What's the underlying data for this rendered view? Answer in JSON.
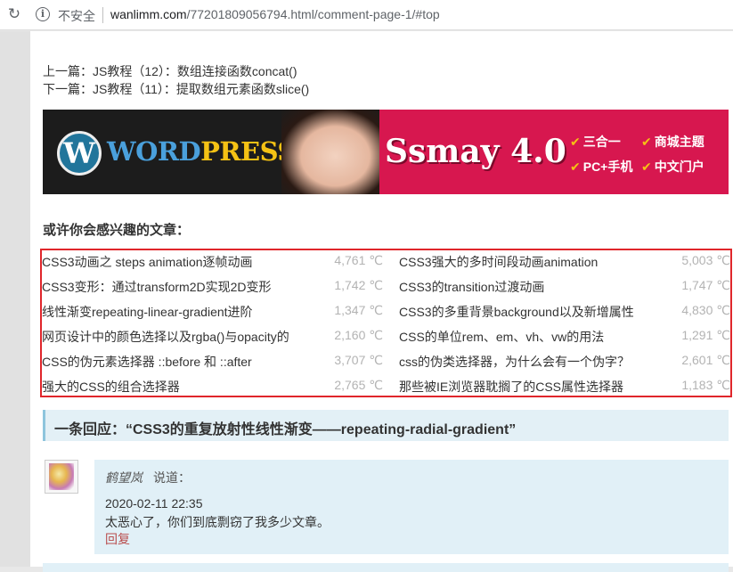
{
  "browser": {
    "security_label": "不安全",
    "url_domain": "wanlimm.com",
    "url_path": "/77201809056794.html/comment-page-1/#top"
  },
  "nav": {
    "prev": "上一篇：JS教程（12）：数组连接函数concat()",
    "next": "下一篇：JS教程（11）：提取数组元素函数slice()"
  },
  "banner": {
    "wp_first": "W",
    "wp_word1": "ORD",
    "wp_word2": "PRESS",
    "product": "Ssmay 4.0",
    "features": [
      "三合一",
      "商城主题",
      "PC+手机",
      "中文门户"
    ]
  },
  "related": {
    "heading": "或许你会感兴趣的文章：",
    "items": [
      {
        "title": "CSS3动画之 steps animation逐帧动画",
        "count": "4,761 ℃"
      },
      {
        "title": "CSS3强大的多时间段动画animation",
        "count": "5,003 ℃"
      },
      {
        "title": "CSS3变形：通过transform2D实现2D变形",
        "count": "1,742 ℃"
      },
      {
        "title": "CSS3的transition过渡动画",
        "count": "1,747 ℃"
      },
      {
        "title": "线性渐变repeating-linear-gradient进阶",
        "count": "1,347 ℃"
      },
      {
        "title": "CSS3的多重背景background以及新增属性",
        "count": "4,830 ℃"
      },
      {
        "title": "网页设计中的颜色选择以及rgba()与opacity的",
        "count": "2,160 ℃"
      },
      {
        "title": "CSS的单位rem、em、vh、vw的用法",
        "count": "1,291 ℃"
      },
      {
        "title": "CSS的伪元素选择器 ::before 和 ::after",
        "count": "3,707 ℃"
      },
      {
        "title": "css的伪类选择器，为什么会有一个伪字？",
        "count": "2,601 ℃"
      },
      {
        "title": "强大的CSS的组合选择器",
        "count": "2,765 ℃"
      },
      {
        "title": "那些被IE浏览器耽搁了的CSS属性选择器",
        "count": "1,183 ℃"
      }
    ]
  },
  "comments": {
    "heading": "一条回应：“CSS3的重复放射性线性渐变——repeating-radial-gradient”",
    "items": [
      {
        "author": "鹤望岚",
        "says": "说道：",
        "date": "2020-02-11 22:35",
        "text": "太恶心了，你们到底剽窃了我多少文章。",
        "reply": "回复"
      }
    ]
  }
}
